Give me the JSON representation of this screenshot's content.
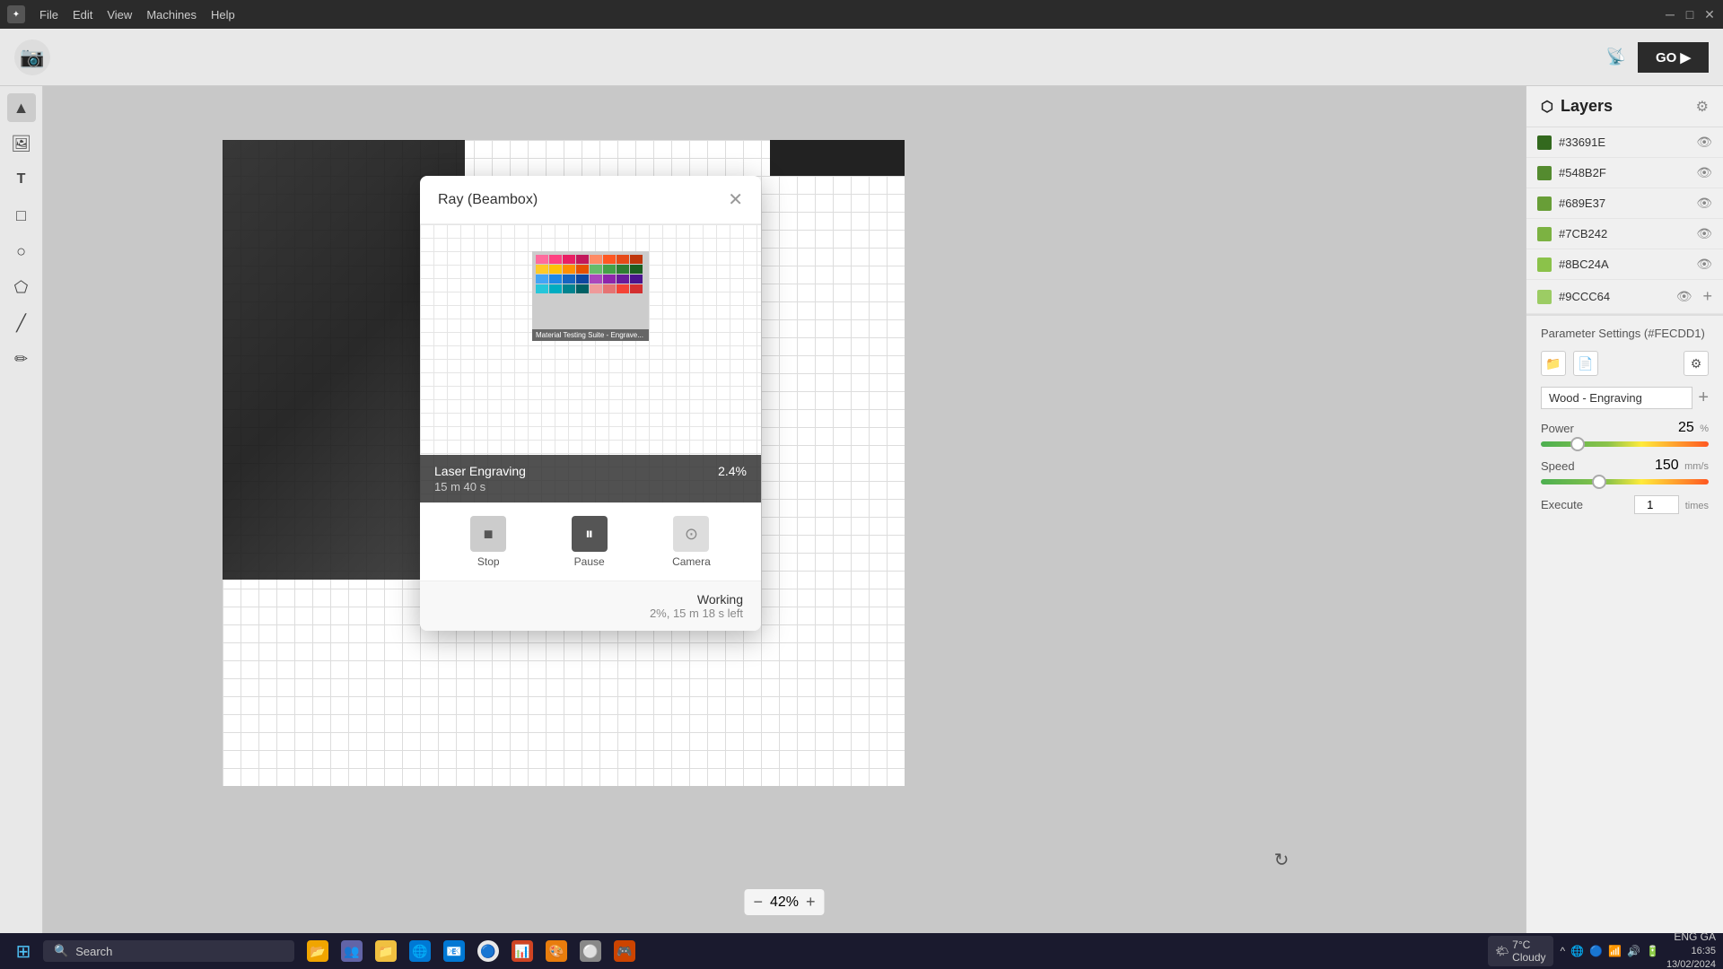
{
  "titlebar": {
    "menu": [
      "File",
      "Edit",
      "View",
      "Machines",
      "Help"
    ],
    "controls": [
      "─",
      "□",
      "✕"
    ]
  },
  "toolbar": {
    "go_label": "GO ▶",
    "camera_icon": "📷"
  },
  "tools": [
    {
      "name": "select",
      "icon": "▲"
    },
    {
      "name": "image",
      "icon": "🖼"
    },
    {
      "name": "text",
      "icon": "T"
    },
    {
      "name": "rect",
      "icon": "□"
    },
    {
      "name": "ellipse",
      "icon": "○"
    },
    {
      "name": "polygon",
      "icon": "⬠"
    },
    {
      "name": "line",
      "icon": "╱"
    },
    {
      "name": "pen",
      "icon": "✏"
    }
  ],
  "canvas": {
    "zoom": "42%",
    "zoom_minus": "−",
    "zoom_plus": "+"
  },
  "layers": {
    "title": "Layers",
    "items": [
      {
        "id": "layer1",
        "color": "#33691E",
        "name": "#33691E"
      },
      {
        "id": "layer2",
        "color": "#548B2F",
        "name": "#548B2F"
      },
      {
        "id": "layer3",
        "color": "#689E37",
        "name": "#689E37"
      },
      {
        "id": "layer4",
        "color": "#7CB242",
        "name": "#7CB242"
      },
      {
        "id": "layer5",
        "color": "#8BC24A",
        "name": "#8BC24A"
      },
      {
        "id": "layer6",
        "color": "#9CCC64",
        "name": "#9CCC64"
      }
    ]
  },
  "parameter_settings": {
    "title": "Parameter Settings (#FECDD1)",
    "preset": "Wood - Engraving",
    "power_label": "Power",
    "power_value": "25",
    "power_unit": "%",
    "power_slider_pct": 22,
    "speed_label": "Speed",
    "speed_value": "150",
    "speed_unit": "mm/s",
    "speed_slider_pct": 35,
    "execute_label": "Execute",
    "execute_value": "1",
    "execute_unit": "times"
  },
  "dialog": {
    "title": "Ray (Beambox)",
    "progress_label": "Laser Engraving",
    "progress_pct": "2.4%",
    "progress_time": "15 m 40 s",
    "stop_label": "Stop",
    "pause_label": "Pause",
    "camera_label": "Camera",
    "status_working": "Working",
    "status_detail": "2%, 15 m 18 s left"
  },
  "taskbar": {
    "search_placeholder": "Search",
    "weather": "7°C",
    "weather_desc": "Cloudy",
    "time": "16:35",
    "date": "13/02/2024",
    "lang": "ENG GA"
  }
}
